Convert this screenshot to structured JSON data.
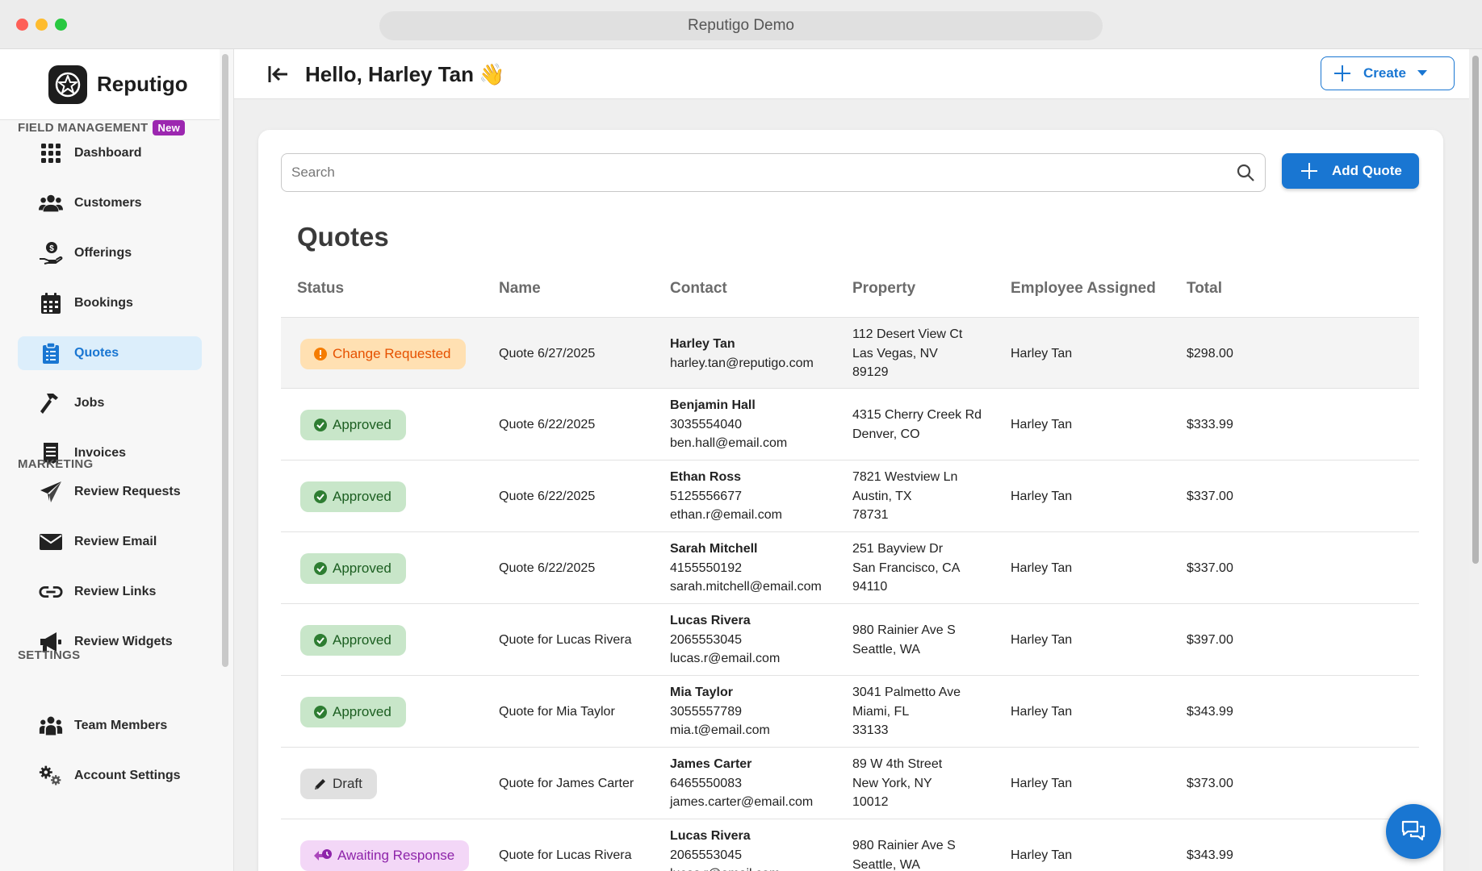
{
  "window": {
    "title": "Reputigo Demo"
  },
  "brand": {
    "name": "Reputigo"
  },
  "header": {
    "greeting": "Hello, Harley Tan",
    "wave": "👋",
    "create_label": "Create"
  },
  "sidebar": {
    "sections": [
      {
        "label": "FIELD MANAGEMENT",
        "badge": "New"
      },
      {
        "label": "MARKETING"
      },
      {
        "label": "SETTINGS"
      }
    ],
    "items": [
      {
        "label": "Dashboard",
        "icon": "dashboard-icon"
      },
      {
        "label": "Customers",
        "icon": "customers-icon"
      },
      {
        "label": "Offerings",
        "icon": "offerings-icon"
      },
      {
        "label": "Bookings",
        "icon": "calendar-icon"
      },
      {
        "label": "Quotes",
        "icon": "clipboard-icon",
        "active": true
      },
      {
        "label": "Jobs",
        "icon": "hammer-icon"
      },
      {
        "label": "Invoices",
        "icon": "invoice-icon"
      },
      {
        "label": "Review Requests",
        "icon": "paper-plane-icon"
      },
      {
        "label": "Review Email",
        "icon": "envelope-icon"
      },
      {
        "label": "Review Links",
        "icon": "link-icon"
      },
      {
        "label": "Review Widgets",
        "icon": "megaphone-icon"
      },
      {
        "label": "Team Members",
        "icon": "team-icon"
      },
      {
        "label": "Account Settings",
        "icon": "gears-icon"
      }
    ]
  },
  "main": {
    "search_placeholder": "Search",
    "add_quote_label": "Add Quote",
    "title": "Quotes",
    "columns": [
      "Status",
      "Name",
      "Contact",
      "Property",
      "Employee Assigned",
      "Total"
    ],
    "colors": {
      "accent": "#1976d2",
      "change": "#e65100",
      "approved": "#1b5e20",
      "awaiting": "#8e24aa"
    },
    "rows": [
      {
        "status": "Change Requested",
        "status_type": "change",
        "name": "Quote 6/27/2025",
        "contact": [
          "Harley Tan",
          "harley.tan@reputigo.com"
        ],
        "property": [
          "112 Desert View Ct",
          "Las Vegas, NV",
          "89129"
        ],
        "employee": "Harley Tan",
        "total": "$298.00"
      },
      {
        "status": "Approved",
        "status_type": "approved",
        "name": "Quote 6/22/2025",
        "contact": [
          "Benjamin Hall",
          "3035554040",
          "ben.hall@email.com"
        ],
        "property": [
          "4315 Cherry Creek Rd",
          "Denver, CO"
        ],
        "employee": "Harley Tan",
        "total": "$333.99"
      },
      {
        "status": "Approved",
        "status_type": "approved",
        "name": "Quote 6/22/2025",
        "contact": [
          "Ethan Ross",
          "5125556677",
          "ethan.r@email.com"
        ],
        "property": [
          "7821 Westview Ln",
          "Austin, TX",
          "78731"
        ],
        "employee": "Harley Tan",
        "total": "$337.00"
      },
      {
        "status": "Approved",
        "status_type": "approved",
        "name": "Quote 6/22/2025",
        "contact": [
          "Sarah Mitchell",
          "4155550192",
          "sarah.mitchell@email.com"
        ],
        "property": [
          "251 Bayview Dr",
          "San Francisco, CA",
          "94110"
        ],
        "employee": "Harley Tan",
        "total": "$337.00"
      },
      {
        "status": "Approved",
        "status_type": "approved",
        "name": "Quote for Lucas Rivera",
        "contact": [
          "Lucas Rivera",
          "2065553045",
          "lucas.r@email.com"
        ],
        "property": [
          "980 Rainier Ave S",
          "Seattle, WA"
        ],
        "employee": "Harley Tan",
        "total": "$397.00"
      },
      {
        "status": "Approved",
        "status_type": "approved",
        "name": "Quote for Mia Taylor",
        "contact": [
          "Mia Taylor",
          "3055557789",
          "mia.t@email.com"
        ],
        "property": [
          "3041 Palmetto Ave",
          "Miami, FL",
          "33133"
        ],
        "employee": "Harley Tan",
        "total": "$343.99"
      },
      {
        "status": "Draft",
        "status_type": "draft",
        "name": "Quote for James Carter",
        "contact": [
          "James Carter",
          "6465550083",
          "james.carter@email.com"
        ],
        "property": [
          "89 W 4th Street",
          "New York, NY",
          "10012"
        ],
        "employee": "Harley Tan",
        "total": "$373.00"
      },
      {
        "status": "Awaiting Response",
        "status_type": "awaiting",
        "name": "Quote for Lucas Rivera",
        "contact": [
          "Lucas Rivera",
          "2065553045",
          "lucas.r@email.com"
        ],
        "property": [
          "980 Rainier Ave S",
          "Seattle, WA"
        ],
        "employee": "Harley Tan",
        "total": "$343.99"
      }
    ]
  }
}
